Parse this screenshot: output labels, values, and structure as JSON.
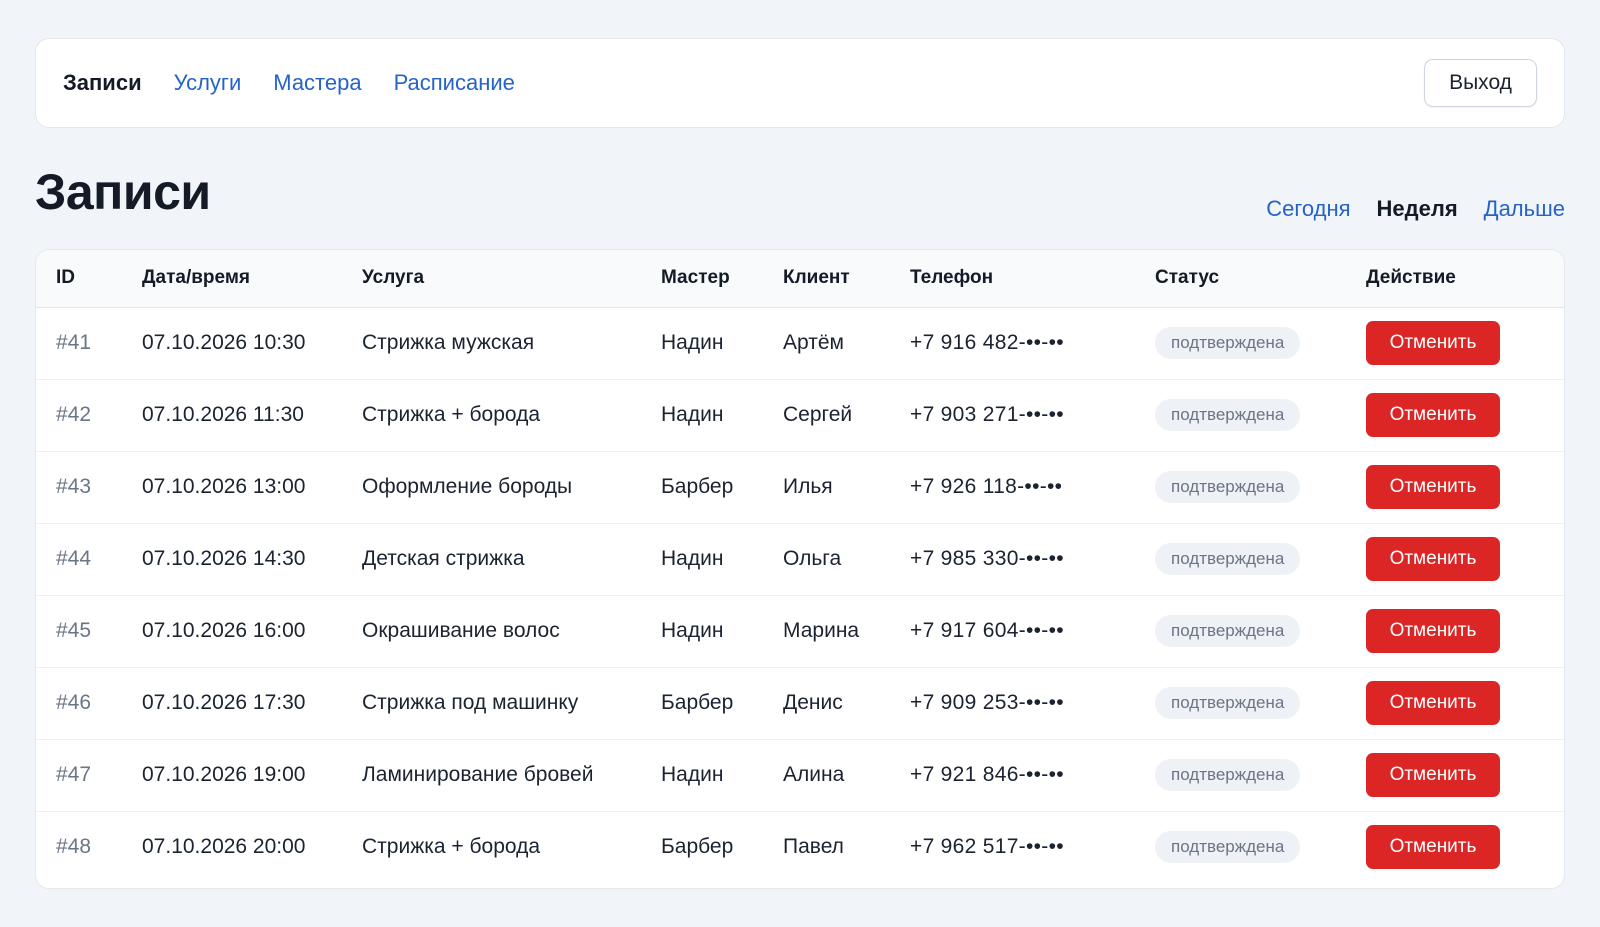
{
  "nav": {
    "items": [
      {
        "label": "Записи",
        "active": true
      },
      {
        "label": "Услуги",
        "active": false
      },
      {
        "label": "Мастера",
        "active": false
      },
      {
        "label": "Расписание",
        "active": false
      }
    ],
    "logout_label": "Выход"
  },
  "page": {
    "title": "Записи"
  },
  "range_filter": {
    "items": [
      {
        "label": "Сегодня",
        "active": false
      },
      {
        "label": "Неделя",
        "active": true
      },
      {
        "label": "Дальше",
        "active": false
      }
    ]
  },
  "table": {
    "columns": [
      "ID",
      "Дата/время",
      "Услуга",
      "Мастер",
      "Клиент",
      "Телефон",
      "Статус",
      "Действие"
    ],
    "rows": [
      {
        "id": "#41",
        "datetime": "07.10.2026 10:30",
        "service": "Стрижка мужская",
        "master": "Надин",
        "client": "Артём",
        "phone": "+7 916 482-••-••",
        "status": "подтверждена",
        "action": "Отменить"
      },
      {
        "id": "#42",
        "datetime": "07.10.2026 11:30",
        "service": "Стрижка + борода",
        "master": "Надин",
        "client": "Сергей",
        "phone": "+7 903 271-••-••",
        "status": "подтверждена",
        "action": "Отменить"
      },
      {
        "id": "#43",
        "datetime": "07.10.2026 13:00",
        "service": "Оформление бороды",
        "master": "Барбер",
        "client": "Илья",
        "phone": "+7 926 118-••-••",
        "status": "подтверждена",
        "action": "Отменить"
      },
      {
        "id": "#44",
        "datetime": "07.10.2026 14:30",
        "service": "Детская стрижка",
        "master": "Надин",
        "client": "Ольга",
        "phone": "+7 985 330-••-••",
        "status": "подтверждена",
        "action": "Отменить"
      },
      {
        "id": "#45",
        "datetime": "07.10.2026 16:00",
        "service": "Окрашивание волос",
        "master": "Надин",
        "client": "Марина",
        "phone": "+7 917 604-••-••",
        "status": "подтверждена",
        "action": "Отменить"
      },
      {
        "id": "#46",
        "datetime": "07.10.2026 17:30",
        "service": "Стрижка под машинку",
        "master": "Барбер",
        "client": "Денис",
        "phone": "+7 909 253-••-••",
        "status": "подтверждена",
        "action": "Отменить"
      },
      {
        "id": "#47",
        "datetime": "07.10.2026 19:00",
        "service": "Ламинирование бровей",
        "master": "Надин",
        "client": "Алина",
        "phone": "+7 921 846-••-••",
        "status": "подтверждена",
        "action": "Отменить"
      },
      {
        "id": "#48",
        "datetime": "07.10.2026 20:00",
        "service": "Стрижка + борода",
        "master": "Барбер",
        "client": "Павел",
        "phone": "+7 962 517-••-••",
        "status": "подтверждена",
        "action": "Отменить"
      }
    ]
  },
  "colors": {
    "link": "#2563c9",
    "danger": "#dc2626",
    "background": "#f1f4f9"
  }
}
